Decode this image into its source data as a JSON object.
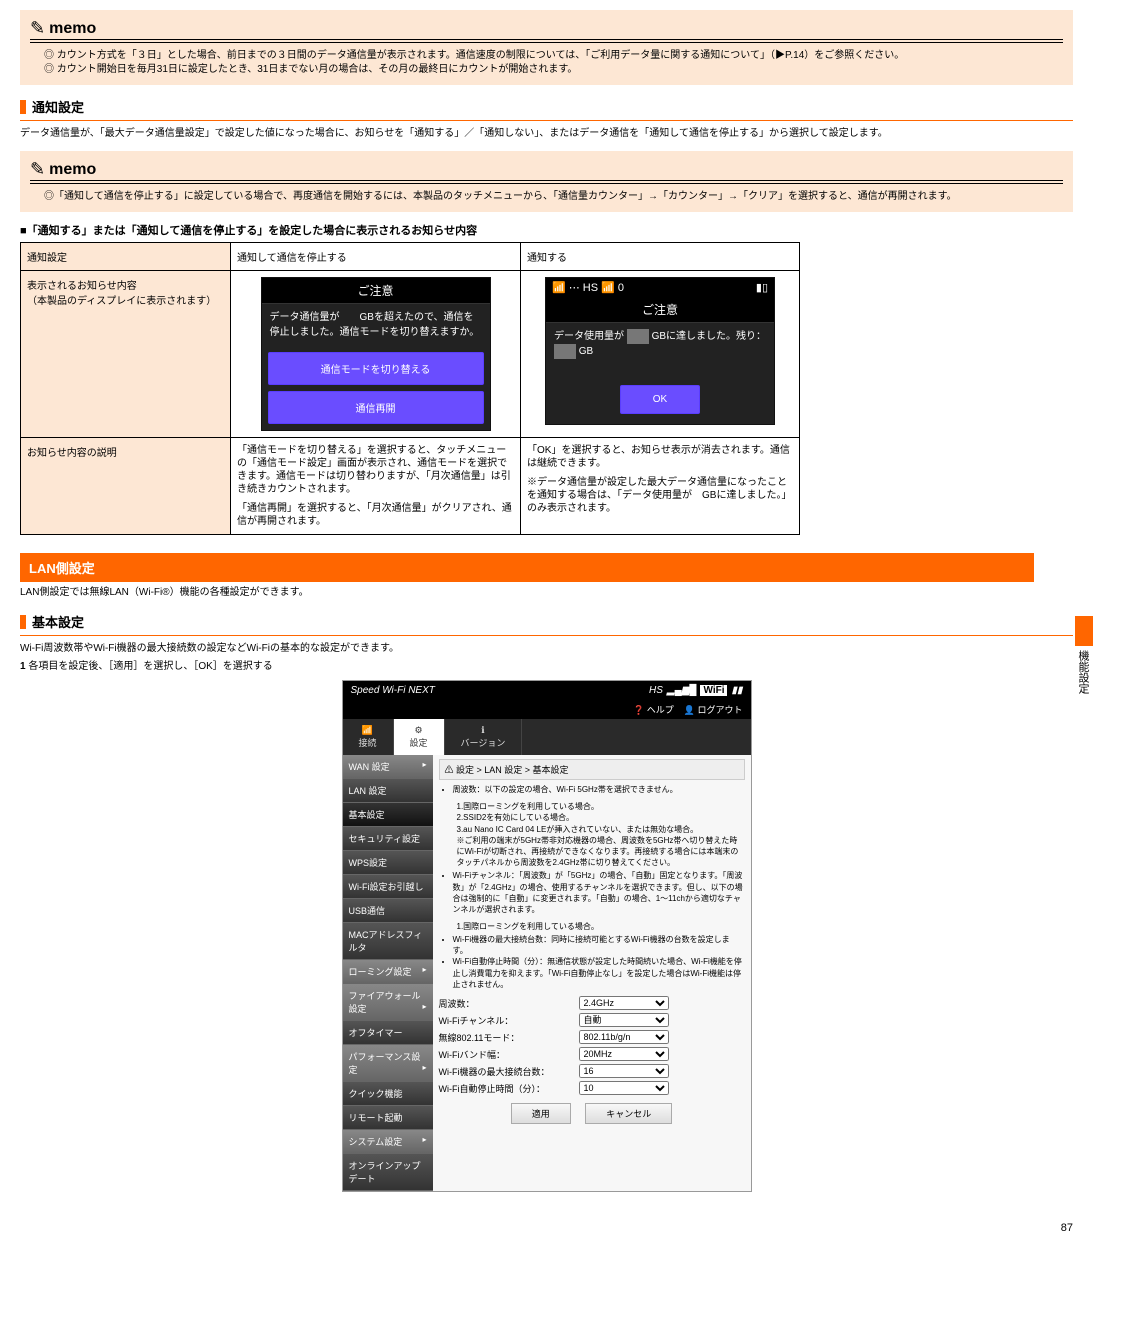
{
  "memo1": {
    "label": "memo",
    "lines": [
      "◎ カウント方式を「３日」とした場合、前日までの３日間のデータ通信量が表示されます。通信速度の制限については、「ご利用データ量に関する通知について」（▶P.14）をご参照ください。",
      "◎ カウント開始日を毎月31日に設定したとき、31日までない月の場合は、その月の最終日にカウントが開始されます。"
    ]
  },
  "sec1": {
    "title": "通知設定",
    "desc": "データ通信量が、「最大データ通信量設定」で設定した値になった場合に、お知らせを「通知する」／「通知しない」、またはデータ通信を「通知して通信を停止する」から選択して設定します。"
  },
  "memo2": {
    "label": "memo",
    "lines": [
      "◎「通知して通信を停止する」に設定している場合で、再度通信を開始するには、本製品のタッチメニューから、「通信量カウンター」→「カウンター」→「クリア」を選択すると、通信が再開されます。"
    ]
  },
  "tableTitle": "■「通知する」または「通知して通信を停止する」を設定した場合に表示されるお知らせ内容",
  "table": {
    "h1": "通知設定",
    "h2": "通知して通信を停止する",
    "h3": "通知する",
    "r1c1_l1": "表示されるお知らせ内容",
    "r1c1_l2": "（本製品のディスプレイに表示されます）",
    "r1c2_title": "ご注意",
    "r1c2_body": "データ通信量が　　GBを超えたので、通信を停止しました。通信モードを切り替えますか。",
    "r1c2_btn1": "通信モードを切り替える",
    "r1c2_btn2": "通信再開",
    "r1c3_status_left": "📶 ⋯ HS 📶 0",
    "r1c3_title": "ご注意",
    "r1c3_body_a": "データ使用量が",
    "r1c3_body_b": "GBに達しました。残り：",
    "r1c3_body_c": "GB",
    "r1c3_btn": "OK",
    "r2": "お知らせ内容の説明",
    "r2c2_1": "「通信モードを切り替える」を選択すると、タッチメニューの「通信モード設定」画面が表示され、通信モードを選択できます。通信モードは切り替わりますが、「月次通信量」は引き続きカウントされます。",
    "r2c2_2": "「通信再開」を選択すると、「月次通信量」がクリアされ、通信が再開されます。",
    "r2c3_1": "「OK」を選択すると、お知らせ表示が消去されます。通信は継続できます。",
    "r2c3_2": "※データ通信量が設定した最大データ通信量になったことを通知する場合は、「データ使用量が　GBに達しました。」のみ表示されます。"
  },
  "lanHead": "LAN側設定",
  "lanDesc": "LAN側設定では無線LAN（Wi-Fi®）機能の各種設定ができます。",
  "basicSec": "基本設定",
  "listItems": [
    "Wi-Fi周波数帯やWi-Fi機器の最大接続数の設定などWi-Fiの基本的な設定ができます。",
    "各項目を設定後、［適用］を選択し、［OK］を選択する"
  ],
  "routerTop": "Speed Wi-Fi NEXT",
  "routerIconsText": "HS",
  "helpText": "ヘルプ",
  "logoutText": "ログアウト",
  "tabs": {
    "t1": "接続",
    "t2": "設定",
    "t3": "バージョン"
  },
  "side": {
    "wan": "WAN 設定",
    "lan": "LAN 設定",
    "basic": "基本設定",
    "sec": "セキュリティ設定",
    "wps": "WPS設定",
    "share": "Wi-Fi設定お引越し",
    "usb": "USB通信",
    "mac": "MACアドレスフィルタ",
    "roam": "ローミング設定",
    "fw": "ファイアウォール設定",
    "off": "オフタイマー",
    "perf": "パフォーマンス設定",
    "quick": "クイック機能",
    "remote": "リモート起動",
    "sys": "システム設定",
    "ota": "オンラインアップデート"
  },
  "crumb": "⚠ 設定 > LAN 設定 > 基本設定",
  "helpList": [
    "周波数：以下の設定の場合、Wi-Fi 5GHz帯を選択できません。",
    "1.国際ローミングを利用している場合。",
    "2.SSID2を有効にしている場合。",
    "3.au Nano IC Card 04 LEが挿入されていない、または無効な場合。",
    "※ご利用の端末が5GHz帯非対応機器の場合、周波数を5GHz帯へ切り替えた時にWi-Fiが切断され、再接続ができなくなります。再接続する場合には本端末のタッチパネルから周波数を2.4GHz帯に切り替えてください。",
    "Wi-Fiチャンネル：「周波数」が「5GHz」の場合、「自動」固定となります。「周波数」が「2.4GHz」の場合、使用するチャンネルを選択できます。但し、以下の場合は強制的に「自動」に変更されます。「自動」の場合、1〜11chから適切なチャンネルが選択されます。",
    "1.国際ローミングを利用している場合。",
    "Wi-Fi機器の最大接続台数：同時に接続可能とするWi-Fi機器の台数を設定します。",
    "Wi-Fi自動停止時間（分）：無通信状態が設定した時間続いた場合、Wi-Fi機能を停止し消費電力を抑えます。「Wi-Fi自動停止なし」を設定した場合はWi-Fi機能は停止されません。"
  ],
  "form": {
    "f1l": "周波数：",
    "f1v": "2.4GHz",
    "f2l": "Wi-Fiチャンネル：",
    "f2v": "自動",
    "f3l": "無線802.11モード：",
    "f3v": "802.11b/g/n",
    "f4l": "Wi-Fiバンド幅：",
    "f4v": "20MHz",
    "f5l": "Wi-Fi機器の最大接続台数：",
    "f5v": "16",
    "f6l": "Wi-Fi自動停止時間（分）：",
    "f6v": "10"
  },
  "btnApply": "適用",
  "btnCancel": "キャンセル",
  "sideTab": "機能設定",
  "pageNum": "87"
}
